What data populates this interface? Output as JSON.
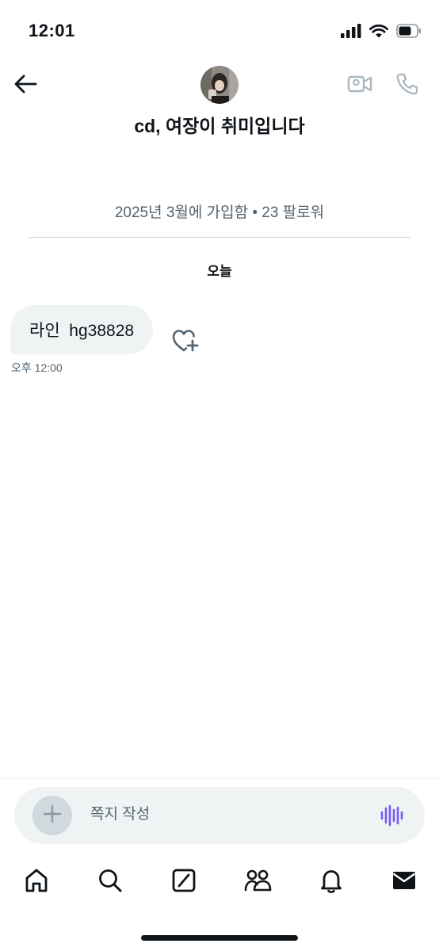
{
  "status_bar": {
    "time": "12:01"
  },
  "header": {
    "title": "cd, 여장이 취미입니다"
  },
  "profile_meta": "2025년 3월에 가입함 • 23 팔로워",
  "date_separator": "오늘",
  "messages": [
    {
      "text": "라인  hg38828",
      "time": "오후 12:00"
    }
  ],
  "composer": {
    "placeholder": "쪽지 작성"
  },
  "colors": {
    "accent_purple": "#7856ff",
    "bubble_bg": "#eff3f4",
    "secondary_text": "#536471",
    "divider": "#cfd9de"
  },
  "icons": {
    "back": "arrow-left-icon",
    "video": "video-camera-icon",
    "call": "phone-icon",
    "react": "heart-plus-icon",
    "add": "plus-icon",
    "voice": "voice-waveform-icon",
    "nav": [
      "home-icon",
      "search-icon",
      "grok-icon",
      "communities-icon",
      "bell-icon",
      "envelope-icon"
    ]
  }
}
